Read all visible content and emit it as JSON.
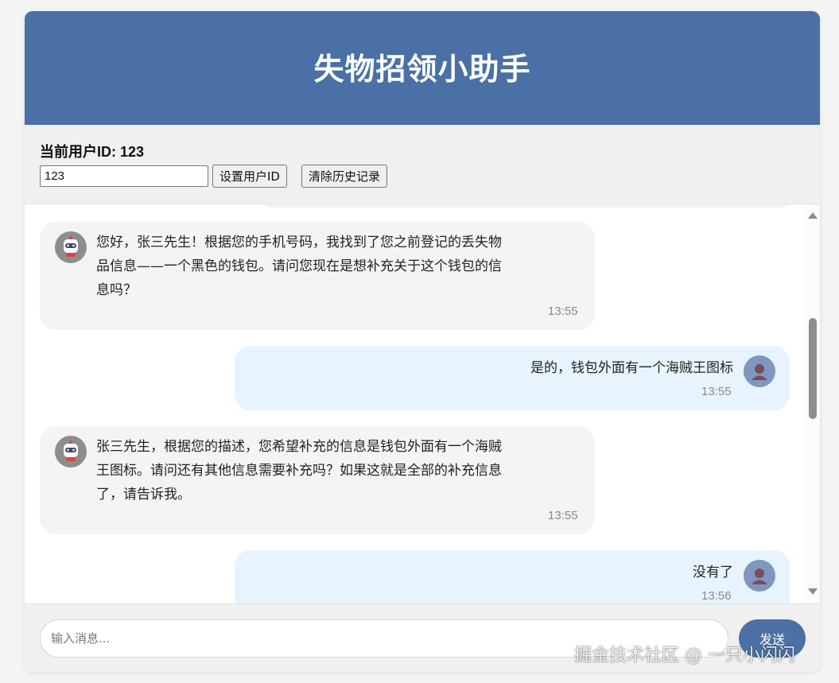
{
  "header": {
    "title": "失物招领小助手"
  },
  "user_panel": {
    "current_user_label": "当前用户ID: 123",
    "user_id_value": "123",
    "set_button": "设置用户ID",
    "clear_button": "清除历史记录"
  },
  "messages": [
    {
      "role": "bot",
      "avatar_icon": "robot-icon",
      "lines": [
        "您好，张三先生！根据您的手机号码，我找到了您之前登记的丢失物",
        "品信息——一个黑色的钱包。请问您现在是想补充关于这个钱包的信",
        "息吗？"
      ],
      "time": "13:55"
    },
    {
      "role": "user",
      "avatar_icon": "user-icon",
      "lines": [
        "是的，钱包外面有一个海贼王图标"
      ],
      "time": "13:55"
    },
    {
      "role": "bot",
      "avatar_icon": "robot-icon",
      "lines": [
        "张三先生，根据您的描述，您希望补充的信息是钱包外面有一个海贼",
        "王图标。请问还有其他信息需要补充吗？如果这就是全部的补充信息",
        "了，请告诉我。"
      ],
      "time": "13:55"
    },
    {
      "role": "user",
      "avatar_icon": "user-icon",
      "lines": [
        "没有了"
      ],
      "time": "13:56"
    }
  ],
  "composer": {
    "placeholder": "输入消息...",
    "send_button": "发送"
  },
  "watermark": "掘金技术社区 @ 一只小闪闪",
  "colors": {
    "header_bg": "#4a70a5",
    "bot_bubble": "#f4f4f4",
    "user_bubble": "#e7f4fd",
    "send_button": "#4a70a5"
  }
}
